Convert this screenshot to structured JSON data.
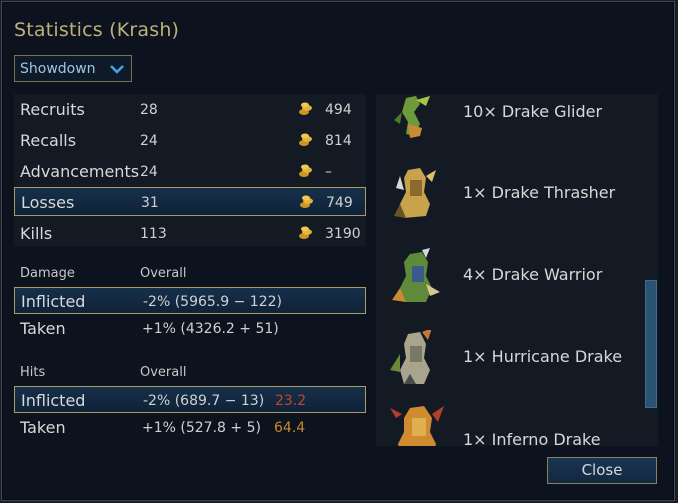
{
  "dialog": {
    "title": "Statistics (Krash)"
  },
  "scenario_select": {
    "selected": "Showdown"
  },
  "summary_rows": [
    {
      "label": "Recruits",
      "count": "28",
      "gold": "494"
    },
    {
      "label": "Recalls",
      "count": "24",
      "gold": "814"
    },
    {
      "label": "Advancements",
      "count": "24",
      "gold": "–"
    },
    {
      "label": "Losses",
      "count": "31",
      "gold": "749"
    },
    {
      "label": "Kills",
      "count": "113",
      "gold": "3190"
    }
  ],
  "damage": {
    "header": "Damage",
    "column": "Overall",
    "rows": [
      {
        "label": "Inflicted",
        "value": "-2% (5965.9 − 122)"
      },
      {
        "label": "Taken",
        "value": "+1% (4326.2 + 51)"
      }
    ]
  },
  "hits": {
    "header": "Hits",
    "column": "Overall",
    "rows": [
      {
        "label": "Inflicted",
        "value": "-2% (689.7 − 13)",
        "extra": "23.2",
        "extra_color": "#c8432b"
      },
      {
        "label": "Taken",
        "value": "+1% (527.8 + 5)",
        "extra": "64.4",
        "extra_color": "#c88a2b"
      }
    ]
  },
  "units": [
    {
      "label": "10× Drake Glider",
      "icon": "drake-glider-sprite"
    },
    {
      "label": "1× Drake Thrasher",
      "icon": "drake-thrasher-sprite"
    },
    {
      "label": "4× Drake Warrior",
      "icon": "drake-warrior-sprite"
    },
    {
      "label": "1× Hurricane Drake",
      "icon": "hurricane-drake-sprite"
    },
    {
      "label": "1× Inferno Drake",
      "icon": "inferno-drake-sprite"
    }
  ],
  "buttons": {
    "close": "Close"
  },
  "colors": {
    "accent_gold": "#a99b63",
    "title": "#bfb07a",
    "selection": "#16304a"
  }
}
